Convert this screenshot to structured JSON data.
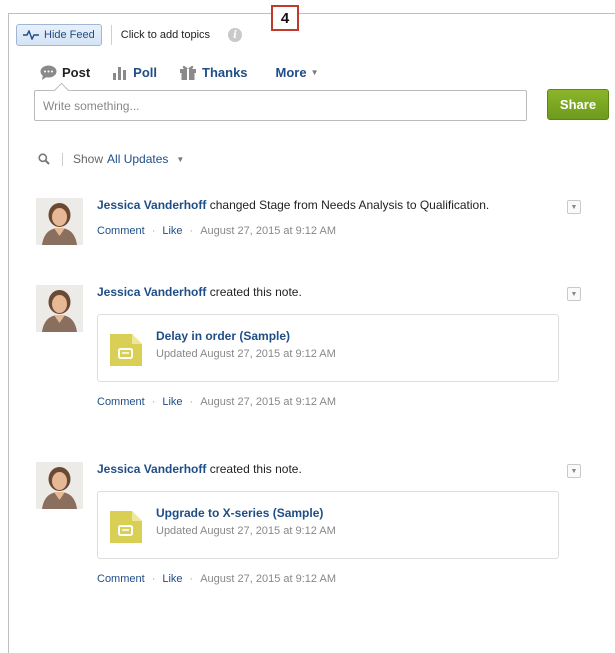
{
  "topbar": {
    "hide_feed_label": "Hide Feed",
    "add_topics_label": "Click to add topics",
    "info_glyph": "i",
    "callout_number": "4"
  },
  "publisher": {
    "tabs": [
      {
        "label": "Post",
        "icon": "speech-bubble-icon"
      },
      {
        "label": "Poll",
        "icon": "bar-chart-icon"
      },
      {
        "label": "Thanks",
        "icon": "gift-icon"
      }
    ],
    "more_label": "More",
    "input_placeholder": "Write something...",
    "share_label": "Share"
  },
  "filter": {
    "show_label": "Show",
    "show_value": "All Updates"
  },
  "feed": [
    {
      "actor": "Jessica Vanderhoff",
      "text": " changed Stage from Needs Analysis to Qualification.",
      "comment_label": "Comment",
      "like_label": "Like",
      "timestamp": "August 27, 2015 at 9:12 AM"
    },
    {
      "actor": "Jessica Vanderhoff",
      "text": " created this note.",
      "attachment": {
        "title": "Delay in order (Sample)",
        "subtitle": "Updated August 27, 2015 at 9:12 AM"
      },
      "comment_label": "Comment",
      "like_label": "Like",
      "timestamp": "August 27, 2015 at 9:12 AM"
    },
    {
      "actor": "Jessica Vanderhoff",
      "text": " created this note.",
      "attachment": {
        "title": "Upgrade to X-series (Sample)",
        "subtitle": "Updated August 27, 2015 at 9:12 AM"
      },
      "comment_label": "Comment",
      "like_label": "Like",
      "timestamp": "August 27, 2015 at 9:12 AM"
    }
  ],
  "colors": {
    "link": "#1f4e86",
    "share_green": "#7aa823",
    "callout_red": "#c0392b",
    "note_yellow": "#d9cf55"
  }
}
